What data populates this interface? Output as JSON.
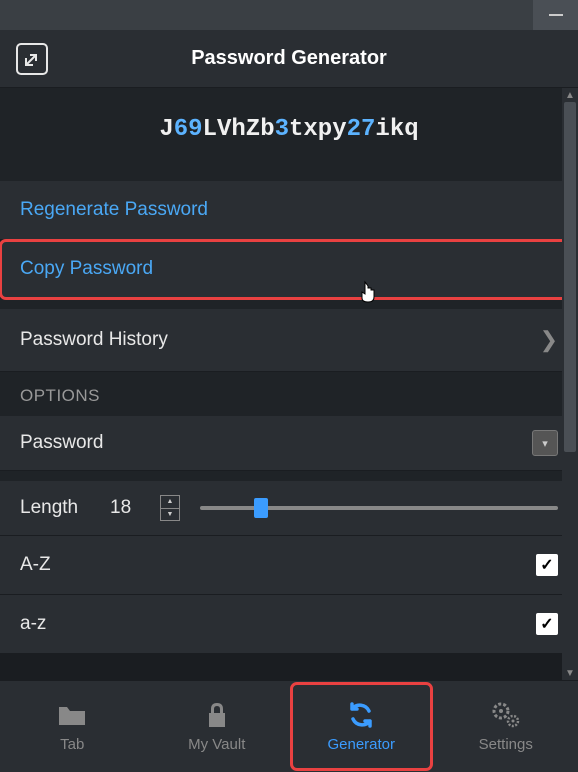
{
  "header": {
    "title": "Password Generator"
  },
  "password": {
    "segments": [
      {
        "t": "J",
        "d": false
      },
      {
        "t": "69",
        "d": true
      },
      {
        "t": "LVhZb",
        "d": false
      },
      {
        "t": "3",
        "d": true
      },
      {
        "t": "txpy",
        "d": false
      },
      {
        "t": "27",
        "d": true
      },
      {
        "t": "ikq",
        "d": false
      }
    ]
  },
  "actions": {
    "regenerate": "Regenerate Password",
    "copy": "Copy Password",
    "history": "Password History"
  },
  "options": {
    "section_label": "OPTIONS",
    "type_selected": "Password",
    "length_label": "Length",
    "length_value": "18",
    "uppercase_label": "A-Z",
    "uppercase_checked": true,
    "lowercase_label": "a-z",
    "lowercase_checked": true
  },
  "nav": {
    "tab": "Tab",
    "vault": "My Vault",
    "generator": "Generator",
    "settings": "Settings"
  }
}
